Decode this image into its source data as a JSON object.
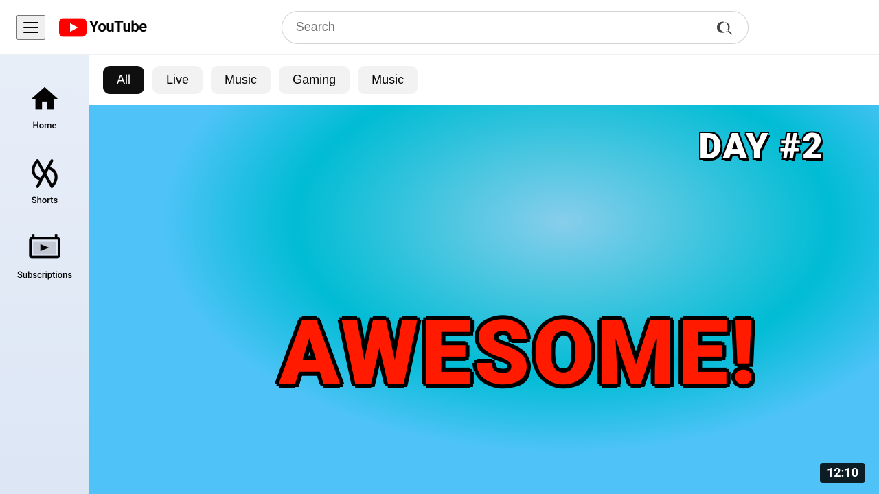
{
  "header": {
    "logo_text": "YouTube",
    "search_placeholder": "Search"
  },
  "sidebar": {
    "items": [
      {
        "id": "home",
        "label": "Home"
      },
      {
        "id": "shorts",
        "label": "Shorts"
      },
      {
        "id": "subscriptions",
        "label": "Subscriptions"
      }
    ]
  },
  "filter_chips": [
    {
      "id": "all",
      "label": "All",
      "active": true
    },
    {
      "id": "live",
      "label": "Live",
      "active": false
    },
    {
      "id": "music",
      "label": "Music",
      "active": false
    },
    {
      "id": "gaming",
      "label": "Gaming",
      "active": false
    },
    {
      "id": "music2",
      "label": "Music",
      "active": false
    }
  ],
  "video": {
    "day_text": "DAY #2",
    "main_text": "AWESOME!",
    "duration": "12:10"
  }
}
